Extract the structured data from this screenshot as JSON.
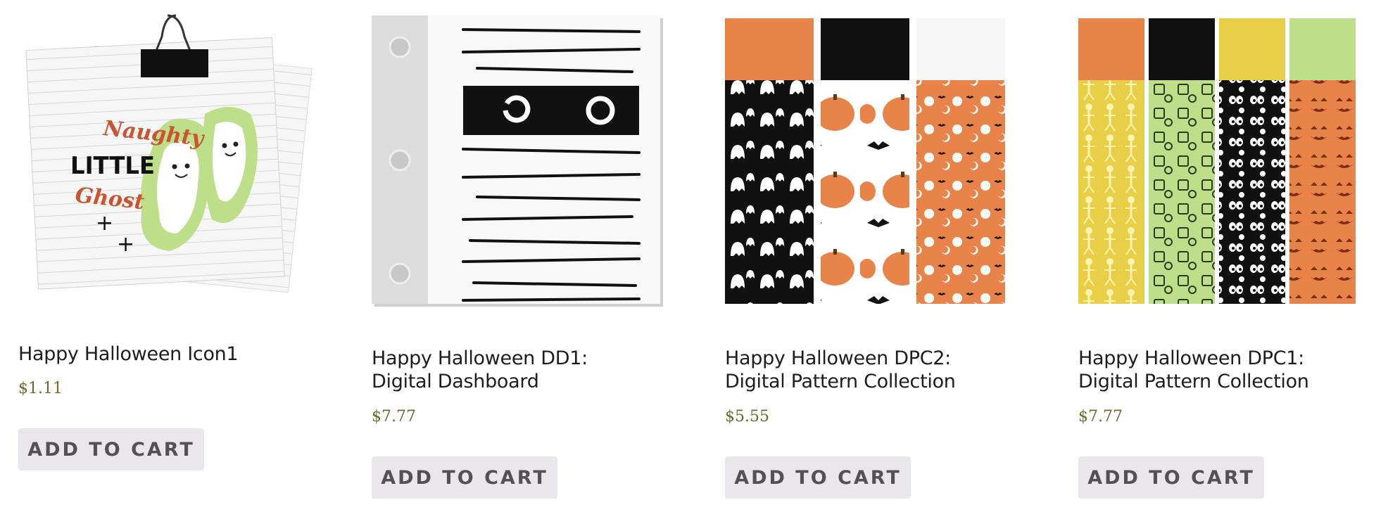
{
  "products": [
    {
      "title": "Happy Halloween Icon1",
      "price": "$1.11",
      "button": "ADD TO CART",
      "image_text": {
        "line1": "Naughty",
        "line2": "LITTLE",
        "line3": "Ghost"
      }
    },
    {
      "title": "Happy Halloween DD1: Digital Dashboard",
      "price": "$7.77",
      "button": "ADD TO CART"
    },
    {
      "title": "Happy Halloween DPC2: Digital Pattern Collection",
      "price": "$5.55",
      "button": "ADD TO CART"
    },
    {
      "title": "Happy Halloween DPC1: Digital Pattern Collection",
      "price": "$7.77",
      "button": "ADD TO CART"
    }
  ],
  "colors": {
    "price": "#6b6a2e",
    "button_bg": "#e9e6ec",
    "button_text": "#555056",
    "orange": "#e8844a",
    "lime": "#bedf8a",
    "yellow": "#e9cf47"
  }
}
